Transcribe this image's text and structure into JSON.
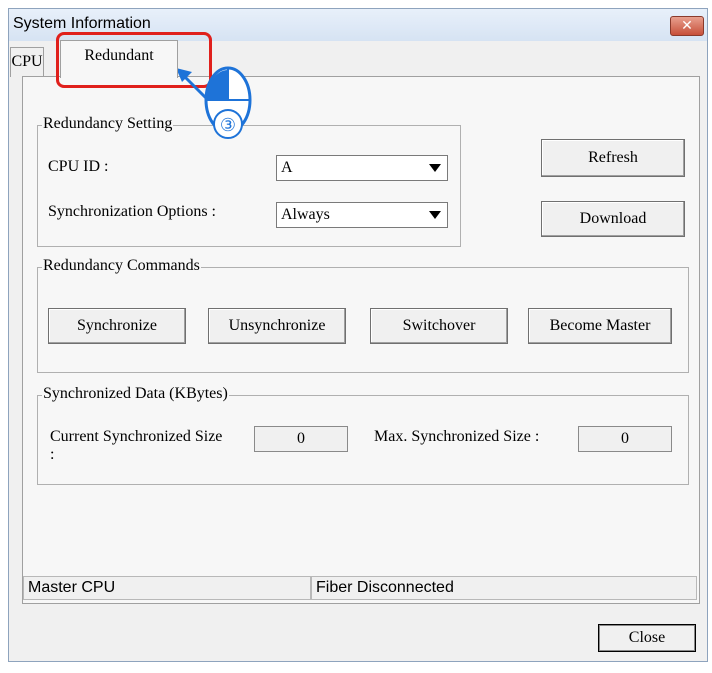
{
  "window": {
    "title": "System Information"
  },
  "tabs": [
    {
      "label": "CPU"
    },
    {
      "label": "Redundant"
    }
  ],
  "redundancy_setting": {
    "legend": "Redundancy Setting",
    "cpu_id_label": "CPU ID :",
    "cpu_id_value": "A",
    "sync_options_label": "Synchronization Options :",
    "sync_options_value": "Always",
    "refresh_label": "Refresh",
    "download_label": "Download"
  },
  "redundancy_commands": {
    "legend": "Redundancy Commands",
    "buttons": [
      "Synchronize",
      "Unsynchronize",
      "Switchover",
      "Become Master"
    ]
  },
  "synchronized_data": {
    "legend": "Synchronized Data (KBytes)",
    "current_label": "Current Synchronized Size :",
    "current_value": "0",
    "max_label": "Max. Synchronized Size :",
    "max_value": "0"
  },
  "status": {
    "left": "Master CPU",
    "right": "Fiber Disconnected"
  },
  "close_label": "Close",
  "annotation": {
    "step": "③",
    "color": "#e0201c",
    "badge_color": "#1e73d8"
  }
}
